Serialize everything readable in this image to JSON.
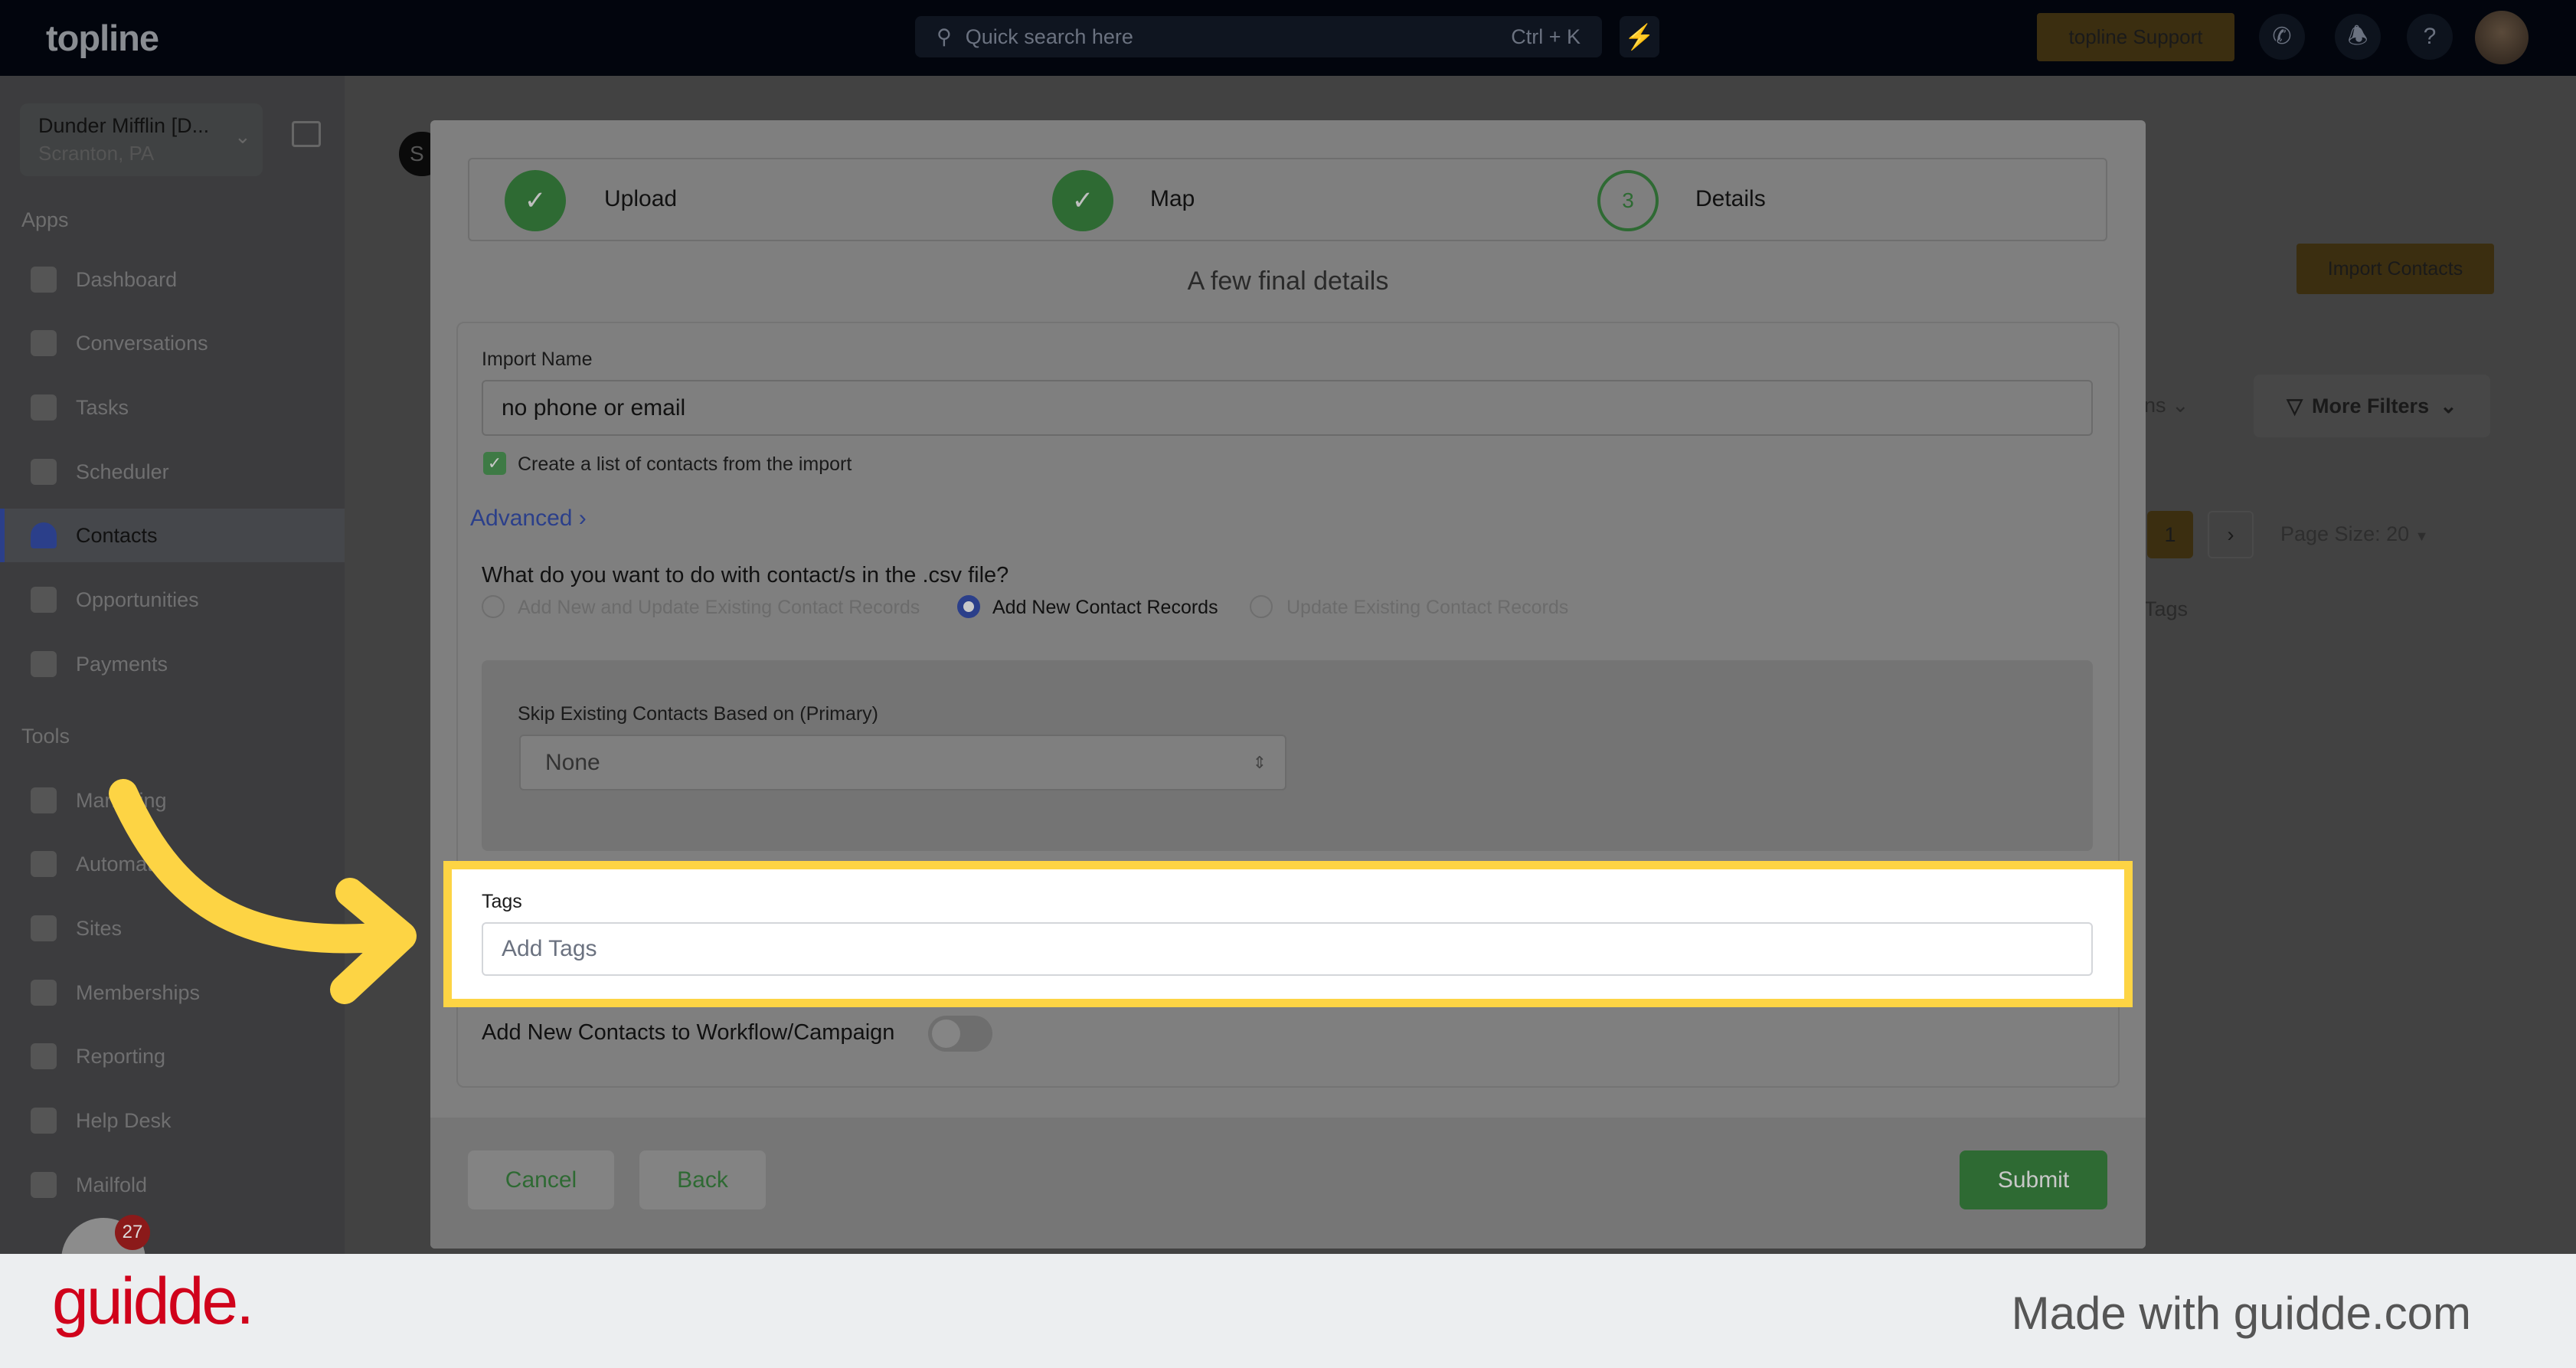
{
  "topbar": {
    "logo": "topline",
    "search_placeholder": "Quick search here",
    "search_shortcut": "Ctrl + K",
    "support_label": "topline Support",
    "accent": "#fdd444"
  },
  "sidebar": {
    "company_name": "Dunder Mifflin [D...",
    "company_location": "Scranton, PA",
    "apps_label": "Apps",
    "apps": [
      {
        "label": "Dashboard"
      },
      {
        "label": "Conversations"
      },
      {
        "label": "Tasks"
      },
      {
        "label": "Scheduler"
      },
      {
        "label": "Contacts",
        "active": true
      },
      {
        "label": "Opportunities"
      },
      {
        "label": "Payments"
      }
    ],
    "tools_label": "Tools",
    "tools": [
      {
        "label": "Marketing"
      },
      {
        "label": "Automation"
      },
      {
        "label": "Sites"
      },
      {
        "label": "Memberships"
      },
      {
        "label": "Reporting"
      },
      {
        "label": "Help Desk"
      },
      {
        "label": "Mailfold"
      }
    ],
    "notification_count": "27"
  },
  "background": {
    "import_contacts": "Import Contacts",
    "columns_partial": "ns",
    "more_filters": "More Filters",
    "current_page": "1",
    "page_size": "Page Size: 20",
    "tags_header": "Tags",
    "tab_partial": "S"
  },
  "modal": {
    "steps": [
      {
        "label": "Upload",
        "status": "done"
      },
      {
        "label": "Map",
        "status": "done"
      },
      {
        "label": "Details",
        "number": "3",
        "status": "current"
      }
    ],
    "subtitle": "A few final details",
    "import_name_label": "Import Name",
    "import_name_value": "no phone or email",
    "create_list_label": "Create a list of contacts from the import",
    "create_list_checked": true,
    "advanced_label": "Advanced",
    "question": "What do you want to do with contact/s in the .csv file?",
    "options": [
      {
        "label": "Add New and Update Existing Contact Records",
        "selected": false
      },
      {
        "label": "Add New Contact Records",
        "selected": true
      },
      {
        "label": "Update Existing Contact Records",
        "selected": false
      }
    ],
    "skip_label": "Skip Existing Contacts Based on (Primary)",
    "skip_value": "None",
    "tags_label": "Tags",
    "tags_placeholder": "Add Tags",
    "workflow_label": "Add New Contacts to Workflow/Campaign",
    "workflow_enabled": false,
    "cancel": "Cancel",
    "back": "Back",
    "submit": "Submit"
  },
  "footer": {
    "logo": "guidde.",
    "made_with": "Made with guidde.com"
  }
}
